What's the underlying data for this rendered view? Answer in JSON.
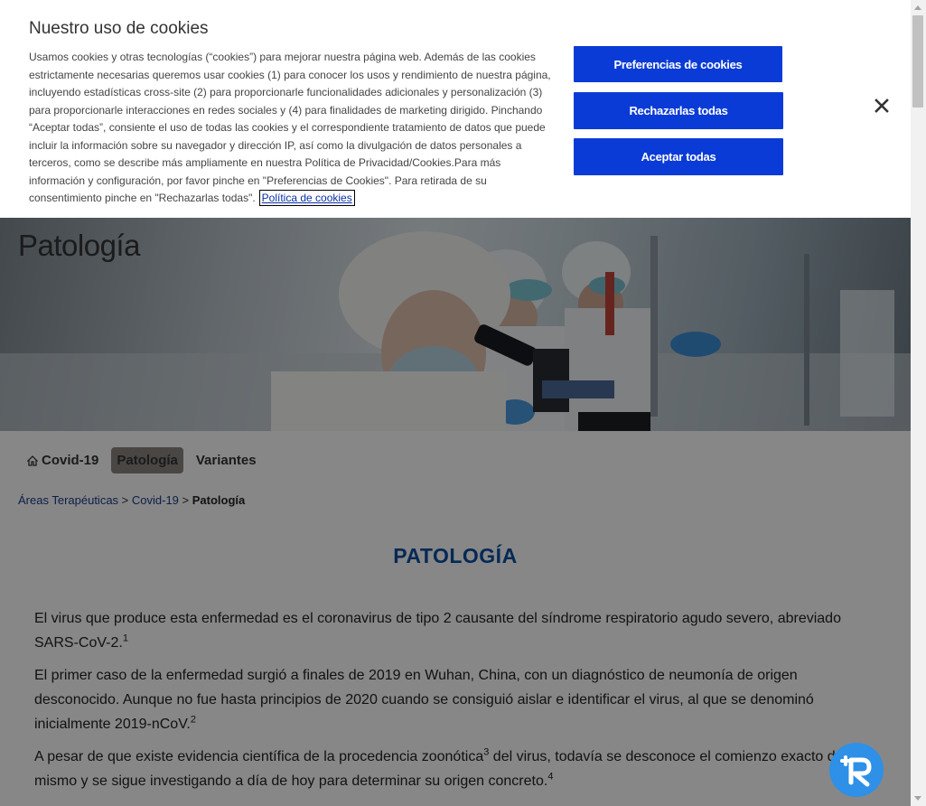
{
  "cookie_banner": {
    "title": "Nuestro uso de cookies",
    "text": "Usamos cookies y otras tecnologías (“cookies”) para mejorar nuestra página web. Además de las cookies estrictamente necesarias queremos usar cookies (1) para conocer los usos y rendimiento de nuestra página, incluyendo estadísticas cross-site (2) para proporcionarle funcionalidades adicionales y personalización (3) para proporcionarle interacciones en redes sociales y (4) para finalidades de marketing dirigido. Pinchando “Aceptar todas”, consiente el uso de todas las cookies y el correspondiente tratamiento de datos que puede incluir la información sobre su navegador y dirección IP, así como la divulgación de datos personales a terceros, como se describe más ampliamente en nuestra Política de Privacidad/Cookies.Para más información y configuración, por favor pinche en \"Preferencias de Cookies\". Para retirada de su consentimiento pinche en \"Rechazarlas todas\".",
    "policy_link": "Política de cookies",
    "buttons": {
      "preferences": "Preferencias de cookies",
      "reject": "Rechazarlas todas",
      "accept": "Aceptar todas"
    },
    "button_color": "#0b3bd6"
  },
  "hero": {
    "title": "Patología"
  },
  "subnav": {
    "items": [
      {
        "label": "Covid-19",
        "icon": "home-icon"
      },
      {
        "label": "Patología",
        "active": true
      },
      {
        "label": "Variantes"
      }
    ]
  },
  "breadcrumb": {
    "items": [
      "Áreas Terapéuticas",
      "Covid-19"
    ],
    "separator": ">",
    "current": "Patología"
  },
  "main": {
    "title": "PATOLOGÍA",
    "title_color": "#0b4ea0",
    "paragraphs": [
      {
        "text": "El virus que produce esta enfermedad es el coronavirus de tipo 2 causante del síndrome respiratorio agudo severo, abreviado SARS-CoV-2.",
        "ref": "1"
      },
      {
        "text": "El primer caso de la enfermedad surgió a finales de 2019 en Wuhan, China, con un diagnóstico de neumonía de origen desconocido. Aunque no fue hasta principios de 2020 cuando se consiguió aislar e identificar el virus, al que se denominó inicialmente 2019-nCoV.",
        "ref": "2"
      },
      {
        "text_a": "A pesar de que existe evidencia científica de la procedencia zoonótica",
        "ref_a": "3",
        "text_b": " del virus, todavía se desconoce el comienzo exacto del mismo y se sigue investigando a día de hoy para determinar su origen concreto.",
        "ref_b": "4"
      }
    ]
  },
  "chatbot": {
    "icon": "chatbot-icon",
    "color": "#2e90e6"
  }
}
